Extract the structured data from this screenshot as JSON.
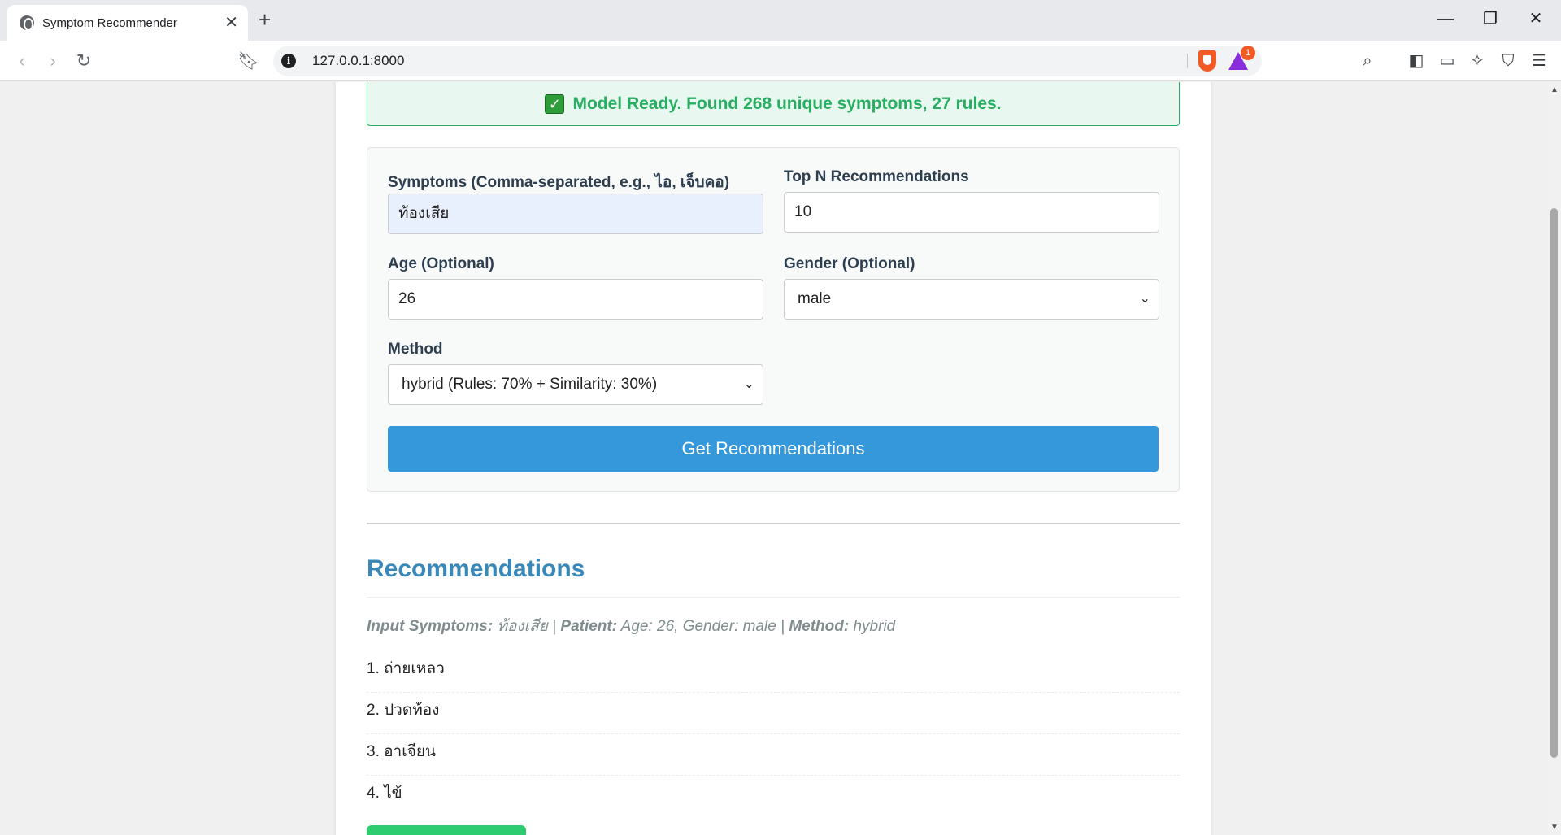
{
  "browser": {
    "tab_title": "Symptom Recommender",
    "tab_close": "✕",
    "new_tab": "+",
    "url": "127.0.0.1:8000",
    "rewards_badge": "1",
    "window": {
      "minimize": "—",
      "restore": "❐",
      "close": "✕"
    }
  },
  "status": {
    "check": "✓",
    "text": "Model Ready. Found 268 unique symptoms, 27 rules."
  },
  "form": {
    "symptoms_label": "Symptoms (Comma-separated, e.g., ไอ, เจ็บคอ)",
    "symptoms_value": "ท้องเสีย",
    "topn_label": "Top N Recommendations",
    "topn_value": "10",
    "age_label": "Age (Optional)",
    "age_value": "26",
    "gender_label": "Gender (Optional)",
    "gender_value": "male",
    "method_label": "Method",
    "method_value": "hybrid (Rules: 70% + Similarity: 30%)",
    "submit_label": "Get Recommendations"
  },
  "results": {
    "title": "Recommendations",
    "summary": {
      "input_label": "Input Symptoms:",
      "input_value": "ท้องเสีย",
      "sep1": "|",
      "patient_label": "Patient:",
      "patient_value": "Age: 26, Gender: male",
      "sep2": "|",
      "method_label": "Method:",
      "method_value": "hybrid"
    },
    "items": [
      "1. ถ่ายเหลว",
      "2. ปวดท้อง",
      "3. อาเจียน",
      "4. ไข้"
    ]
  },
  "colors": {
    "status_green": "#27ae60",
    "primary_blue": "#3498db",
    "heading_blue": "#3a88b8",
    "label_dark": "#2c3e50",
    "muted_gray": "#7f8c8d",
    "success_button": "#2ecc71"
  }
}
